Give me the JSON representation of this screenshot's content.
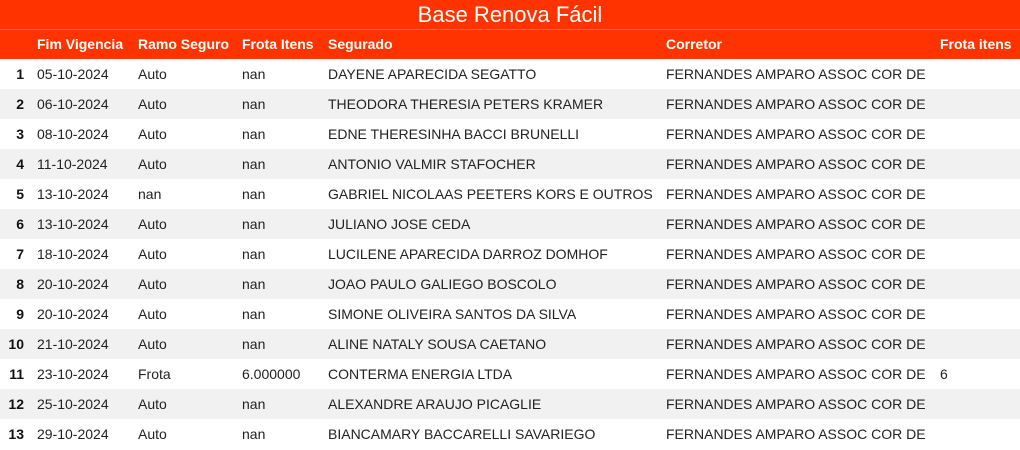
{
  "title": "Base Renova Fácil",
  "columns": [
    "Fim Vigencia",
    "Ramo Seguro",
    "Frota Itens",
    "Segurado",
    "Corretor",
    "Frota itens"
  ],
  "rows": [
    {
      "idx": "1",
      "fim": "05-10-2024",
      "ramo": "Auto",
      "frota": "nan",
      "segurado": "DAYENE APARECIDA SEGATTO",
      "corretor": "FERNANDES AMPARO ASSOC COR DE",
      "frota2": ""
    },
    {
      "idx": "2",
      "fim": "06-10-2024",
      "ramo": "Auto",
      "frota": "nan",
      "segurado": "THEODORA THERESIA PETERS KRAMER",
      "corretor": "FERNANDES AMPARO ASSOC COR DE",
      "frota2": ""
    },
    {
      "idx": "3",
      "fim": "08-10-2024",
      "ramo": "Auto",
      "frota": "nan",
      "segurado": "EDNE THERESINHA BACCI BRUNELLI",
      "corretor": "FERNANDES AMPARO ASSOC COR DE",
      "frota2": ""
    },
    {
      "idx": "4",
      "fim": "11-10-2024",
      "ramo": "Auto",
      "frota": "nan",
      "segurado": "ANTONIO VALMIR STAFOCHER",
      "corretor": "FERNANDES AMPARO ASSOC COR DE",
      "frota2": ""
    },
    {
      "idx": "5",
      "fim": "13-10-2024",
      "ramo": "nan",
      "frota": "nan",
      "segurado": "GABRIEL NICOLAAS PEETERS KORS E OUTROS",
      "corretor": "FERNANDES AMPARO ASSOC COR DE",
      "frota2": ""
    },
    {
      "idx": "6",
      "fim": "13-10-2024",
      "ramo": "Auto",
      "frota": "nan",
      "segurado": "JULIANO JOSE CEDA",
      "corretor": "FERNANDES AMPARO ASSOC COR DE",
      "frota2": ""
    },
    {
      "idx": "7",
      "fim": "18-10-2024",
      "ramo": "Auto",
      "frota": "nan",
      "segurado": "LUCILENE APARECIDA DARROZ DOMHOF",
      "corretor": "FERNANDES AMPARO ASSOC COR DE",
      "frota2": ""
    },
    {
      "idx": "8",
      "fim": "20-10-2024",
      "ramo": "Auto",
      "frota": "nan",
      "segurado": "JOAO PAULO GALIEGO BOSCOLO",
      "corretor": "FERNANDES AMPARO ASSOC COR DE",
      "frota2": ""
    },
    {
      "idx": "9",
      "fim": "20-10-2024",
      "ramo": "Auto",
      "frota": "nan",
      "segurado": "SIMONE OLIVEIRA SANTOS DA SILVA",
      "corretor": "FERNANDES AMPARO ASSOC COR DE",
      "frota2": ""
    },
    {
      "idx": "10",
      "fim": "21-10-2024",
      "ramo": "Auto",
      "frota": "nan",
      "segurado": "ALINE NATALY SOUSA CAETANO",
      "corretor": "FERNANDES AMPARO ASSOC COR DE",
      "frota2": ""
    },
    {
      "idx": "11",
      "fim": "23-10-2024",
      "ramo": "Frota",
      "frota": "6.000000",
      "segurado": "CONTERMA ENERGIA LTDA",
      "corretor": "FERNANDES AMPARO ASSOC COR DE",
      "frota2": "6"
    },
    {
      "idx": "12",
      "fim": "25-10-2024",
      "ramo": "Auto",
      "frota": "nan",
      "segurado": "ALEXANDRE ARAUJO PICAGLIE",
      "corretor": "FERNANDES AMPARO ASSOC COR DE",
      "frota2": ""
    },
    {
      "idx": "13",
      "fim": "29-10-2024",
      "ramo": "Auto",
      "frota": "nan",
      "segurado": "BIANCAMARY BACCARELLI SAVARIEGO",
      "corretor": "FERNANDES AMPARO ASSOC COR DE",
      "frota2": ""
    }
  ],
  "colors": {
    "header_bg": "#ff3300",
    "header_text": "#ffffff",
    "row_alt": "#f1f1f1"
  }
}
